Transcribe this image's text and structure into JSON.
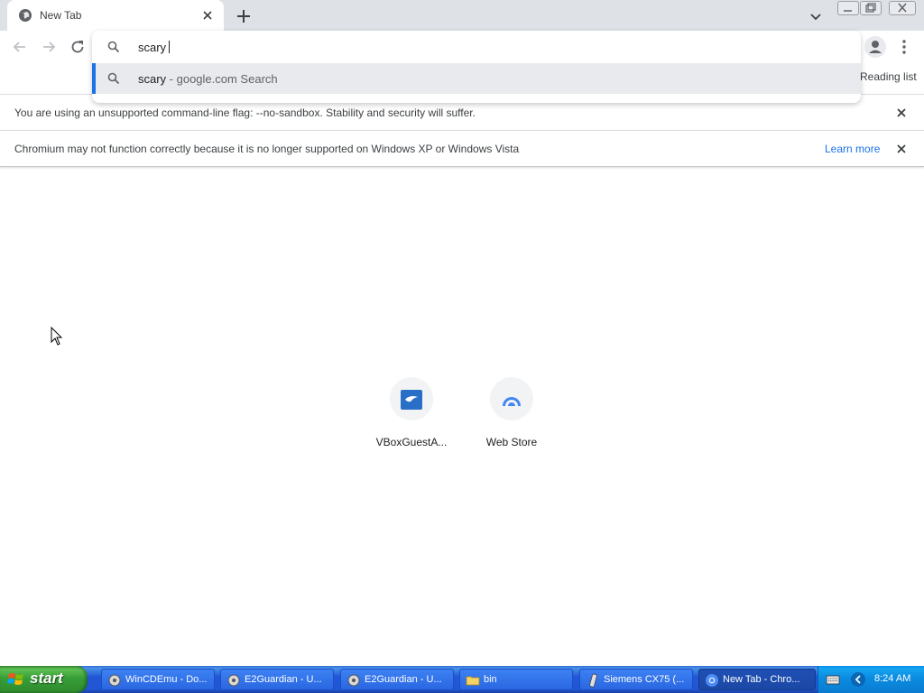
{
  "browser": {
    "tab": {
      "title": "New Tab",
      "favicon": "globe-icon",
      "close_icon": "close-icon"
    },
    "new_tab_icon": "plus-icon",
    "tab_search_icon": "chevron-down-icon",
    "window_controls": [
      "minimize-icon",
      "maximize-icon",
      "close-icon"
    ],
    "toolbar": {
      "back_icon": "back-arrow-icon",
      "forward_icon": "forward-arrow-icon",
      "reload_icon": "reload-icon",
      "profile_icon": "profile-icon",
      "menu_icon": "kebab-menu-icon",
      "reading_list_label": "Reading list"
    },
    "omnibox": {
      "input_value": "scary",
      "suggestions": [
        {
          "query": "scary",
          "suffix": " - google.com Search",
          "icon": "search-icon",
          "selected": true
        }
      ]
    },
    "infobars": [
      {
        "message": "You are using an unsupported command-line flag: --no-sandbox. Stability and security will suffer.",
        "close_icon": "close-icon"
      },
      {
        "message": "Chromium may not function correctly because it is no longer supported on Windows XP or Windows Vista",
        "link_label": "Learn more",
        "close_icon": "close-icon"
      }
    ],
    "shortcuts": [
      {
        "label": "VBoxGuestA...",
        "icon": "vbox-icon"
      },
      {
        "label": "Web Store",
        "icon": "web-store-icon"
      }
    ]
  },
  "taskbar": {
    "start_label": "start",
    "tasks": [
      {
        "label": "WinCDEmu - Do...",
        "icon": "wincdemu-icon",
        "active": false
      },
      {
        "label": "E2Guardian - U...",
        "icon": "e2guardian-icon",
        "active": false
      },
      {
        "label": "E2Guardian - U...",
        "icon": "e2guardian-icon",
        "active": false
      },
      {
        "label": "bin",
        "icon": "folder-icon",
        "active": false
      },
      {
        "label": "Siemens CX75 (...",
        "icon": "phone-icon",
        "active": false
      },
      {
        "label": "New Tab - Chro...",
        "icon": "chromium-icon",
        "active": true
      }
    ],
    "clock": "8:24 AM"
  },
  "colors": {
    "accent": "#1a73e8",
    "tabstrip": "#dee1e6",
    "taskbar": "#2157d7",
    "start_button": "#379e37"
  }
}
